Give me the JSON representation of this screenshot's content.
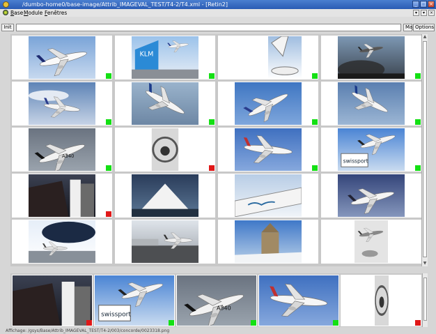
{
  "window": {
    "title": "/dumbo-home0/base-image/Attrib_IMAGEVAL_TEST/T4-2/T4.xml - [Retin2]",
    "buttons": [
      "_",
      "□",
      "×"
    ]
  },
  "menubar": {
    "items": [
      "Base",
      "Module",
      "Fenêtres"
    ],
    "mdi_buttons": [
      "▾",
      "▾",
      "×"
    ]
  },
  "toolbar": {
    "init_label": "Init",
    "maj_label": "Maj",
    "options_label": "Options"
  },
  "colors": {
    "flag_positive": "#14e014",
    "flag_negative": "#e01818",
    "titlebar": "#2a5bb4"
  },
  "grid": {
    "rows": 5,
    "cols": 4,
    "items": [
      {
        "subject": "concorde",
        "flag": "green"
      },
      {
        "subject": "klm-tail",
        "flag": "green"
      },
      {
        "subject": "tail-closeup",
        "flag": "green"
      },
      {
        "subject": "jet-smoke",
        "flag": "green"
      },
      {
        "subject": "jet-cloudy",
        "flag": "green"
      },
      {
        "subject": "jet-banking",
        "flag": "green"
      },
      {
        "subject": "jet-blue-sky",
        "flag": "green"
      },
      {
        "subject": "jet-takeoff",
        "flag": "green"
      },
      {
        "subject": "a340",
        "flag": "green"
      },
      {
        "subject": "bw-sculpture",
        "flag": "red"
      },
      {
        "subject": "jet-front",
        "flag": "green"
      },
      {
        "subject": "swissport",
        "flag": "green"
      },
      {
        "subject": "gate-dark",
        "flag": "red"
      },
      {
        "subject": "mountain",
        "flag": "none"
      },
      {
        "subject": "fuselage-map",
        "flag": "none"
      },
      {
        "subject": "jet-landing",
        "flag": "none"
      },
      {
        "subject": "engine-closeup",
        "flag": "none"
      },
      {
        "subject": "apron-jet",
        "flag": "none"
      },
      {
        "subject": "church",
        "flag": "none"
      },
      {
        "subject": "bw-biplane",
        "flag": "none"
      }
    ]
  },
  "strip": {
    "items": [
      {
        "subject": "gate-dark",
        "flag": "red"
      },
      {
        "subject": "swissport",
        "flag": "green"
      },
      {
        "subject": "a340",
        "flag": "green"
      },
      {
        "subject": "jet-front",
        "flag": "green"
      },
      {
        "subject": "bw-sculpture",
        "flag": "red"
      }
    ]
  },
  "status_text": "Affichage: /gsys/Base/Attrib_IMAGEVAL_TEST/T4-2/003/concorde/0023318.png"
}
